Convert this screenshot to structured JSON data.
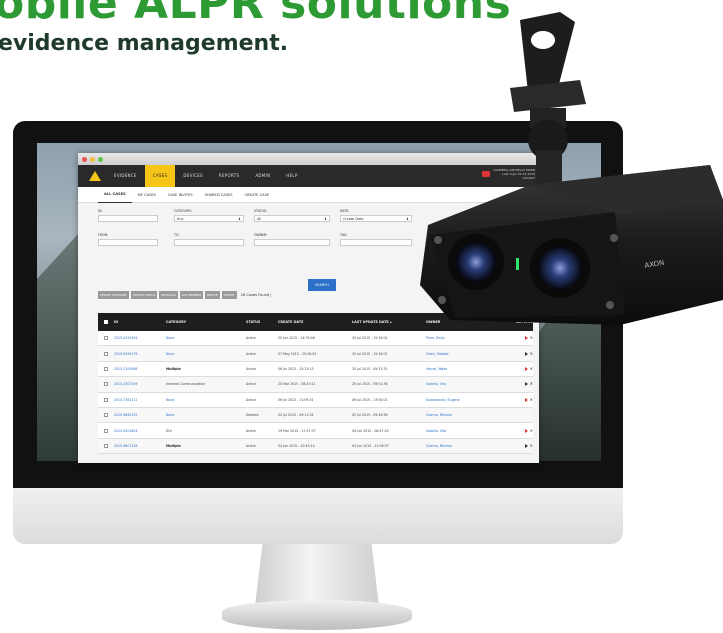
{
  "headline": "obile ALPR solutions",
  "subheadline": "evidence management.",
  "app": {
    "nav": [
      "EVIDENCE",
      "CASES",
      "DEVICES",
      "REPORTS",
      "ADMIN",
      "HELP"
    ],
    "active_nav": "CASES",
    "user_lines": [
      "CAMPBELL-MICHELLE EWEN",
      "Last login 02.13.2015",
      "LOGOUT"
    ],
    "subtabs": [
      "ALL CASES",
      "MY CASES",
      "CASE INVITES",
      "SHARED CASES",
      "CREATE CASE"
    ],
    "filters": {
      "id_label": "ID:",
      "category_label": "CATEGORY:",
      "category_value": "Any",
      "status_label": "STATUS:",
      "status_value": "All",
      "dates_label": "DATE:",
      "dates_value": "Create Date",
      "from_label": "FROM:",
      "to_label": "TO:",
      "owner_label": "OWNER:",
      "tag_label": "TAG:",
      "search_button": "SEARCH"
    },
    "action_buttons": [
      "UPDATE CATEGORY",
      "UPDATE STATUS",
      "REASSIGN",
      "ADD MEMBER",
      "DELETE",
      "EXPORT"
    ],
    "found_text": "26 Cases Found |",
    "table": {
      "headers": [
        "ID",
        "CATEGORY",
        "STATUS",
        "CREATE DATE",
        "LAST UPDATE DATE ▴",
        "OWNER",
        "ACTIONS"
      ],
      "rows": [
        {
          "id": "2015-4320394",
          "category": "None",
          "cat_style": "link",
          "status": "Active",
          "created": "20 Jun 2015 - 14:33:46",
          "updated": "20 Jul 2015 - 15:34:04",
          "owner": "Phan, Emily",
          "actions": 2
        },
        {
          "id": "2015-6395179",
          "category": "None",
          "cat_style": "link",
          "status": "Active",
          "created": "07 May 2015 - 15:26:03",
          "updated": "20 Jul 2015 - 15:34:01",
          "owner": "Eiden, Maddie",
          "actions": 2
        },
        {
          "id": "2015-3105988",
          "category": "Multiple",
          "cat_style": "bold",
          "status": "Active",
          "created": "06 Jul 2015 - 15:23:13",
          "updated": "20 Jul 2015 - 09:31:31",
          "owner": "Hamel, Wade",
          "actions": 2
        },
        {
          "id": "2015-4307209",
          "category": "Immoral Communication",
          "cat_style": "plain",
          "status": "Active",
          "created": "20 Mar 2015 - 08:43:11",
          "updated": "20 Jul 2015 - 09:51:36",
          "owner": "Sabella, Vito",
          "actions": 2
        },
        {
          "id": "2015-7381111",
          "category": "None",
          "cat_style": "link",
          "status": "Active",
          "created": "06 Jul 2015 - 11:09:31",
          "updated": "06 Jul 2015 - 13:00:01",
          "owner": "Kolosvansky, Eugene",
          "actions": 2
        },
        {
          "id": "2015-9890125",
          "category": "None",
          "cat_style": "link",
          "status": "Deleted",
          "created": "02 Jul 2015 - 09:11:34",
          "updated": "02 Jul 2015 - 09:44:56",
          "owner": "Guerna, Michela",
          "actions": 0
        },
        {
          "id": "2015-4201804",
          "category": "DUI",
          "cat_style": "plain",
          "status": "Active",
          "created": "19 Mar 2015 - 17:57:37",
          "updated": "04 Jun 2015 - 08:47:43",
          "owner": "Sabella, Vito",
          "actions": 2
        },
        {
          "id": "2015-9807126",
          "category": "Multiple",
          "cat_style": "bold",
          "status": "Active",
          "created": "04 Jun 2015 - 10:43:14",
          "updated": "04 Jun 2015 - 11:09:57",
          "owner": "Guerna, Michela",
          "actions": 2
        }
      ]
    }
  },
  "camera": {
    "brand": "AXON"
  },
  "colors": {
    "headline": "#2e9a33",
    "subheadline": "#1f3a2a",
    "accent": "#f5c518",
    "link": "#2b70c9"
  }
}
